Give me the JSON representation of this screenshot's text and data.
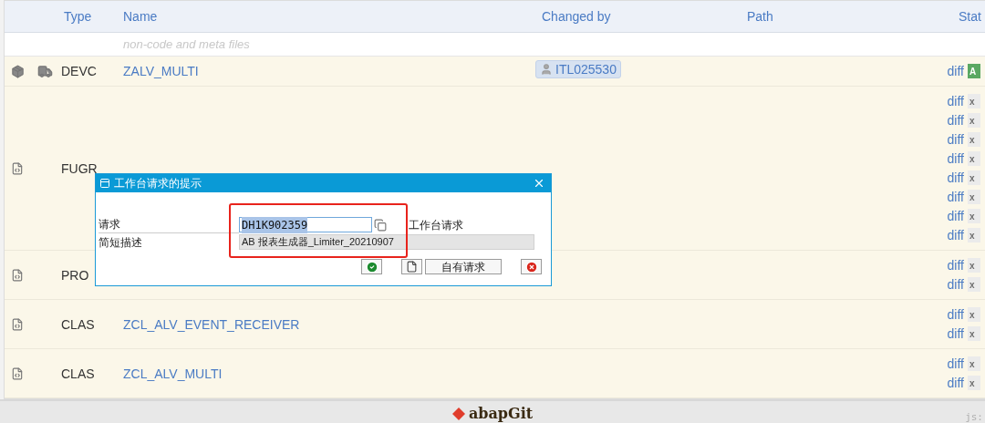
{
  "table": {
    "columns": [
      "Type",
      "Name",
      "Changed by",
      "Path",
      "Stat"
    ],
    "rows": [
      {
        "kind": "note",
        "text": "non-code and meta files"
      },
      {
        "kind": "package",
        "type": "DEVC",
        "name": "ZALV_MULTI",
        "changed_by": "ITL025530",
        "diffs": [
          {
            "label": "diff",
            "status": "A",
            "kind": "added"
          }
        ]
      },
      {
        "kind": "file",
        "type": "FUGR",
        "diffs": [
          {
            "label": "diff",
            "status": "x",
            "kind": "unchanged"
          },
          {
            "label": "diff",
            "status": "x",
            "kind": "unchanged"
          },
          {
            "label": "diff",
            "status": "x",
            "kind": "unchanged"
          },
          {
            "label": "diff",
            "status": "x",
            "kind": "unchanged"
          },
          {
            "label": "diff",
            "status": "x",
            "kind": "unchanged"
          },
          {
            "label": "diff",
            "status": "x",
            "kind": "unchanged"
          },
          {
            "label": "diff",
            "status": "x",
            "kind": "unchanged"
          },
          {
            "label": "diff",
            "status": "x",
            "kind": "unchanged"
          }
        ]
      },
      {
        "kind": "file",
        "type": "PRO",
        "diffs": [
          {
            "label": "diff",
            "status": "x",
            "kind": "unchanged"
          },
          {
            "label": "diff",
            "status": "x",
            "kind": "unchanged"
          }
        ]
      },
      {
        "kind": "file",
        "type": "CLAS",
        "name": "ZCL_ALV_EVENT_RECEIVER",
        "diffs": [
          {
            "label": "diff",
            "status": "x",
            "kind": "unchanged"
          },
          {
            "label": "diff",
            "status": "x",
            "kind": "unchanged"
          }
        ]
      },
      {
        "kind": "file",
        "type": "CLAS",
        "name": "ZCL_ALV_MULTI",
        "diffs": [
          {
            "label": "diff",
            "status": "x",
            "kind": "unchanged"
          },
          {
            "label": "diff",
            "status": "x",
            "kind": "unchanged"
          }
        ]
      }
    ]
  },
  "dialog": {
    "title": "工作台请求的提示",
    "fields": [
      {
        "label": "请求",
        "value": "DH1K902359",
        "highlighted": true,
        "disabled": false,
        "suffix": "工作台请求"
      },
      {
        "label": "简短描述",
        "value": "AB 报表生成器_Limiter_20210907",
        "highlighted": false,
        "disabled": true
      }
    ],
    "buttons": [
      {
        "kind": "confirm"
      },
      {
        "kind": "new"
      },
      {
        "kind": "text",
        "label": "自有请求"
      },
      {
        "kind": "cancel"
      }
    ]
  },
  "footer": {
    "logo": "abapGit",
    "hint": "js:"
  }
}
